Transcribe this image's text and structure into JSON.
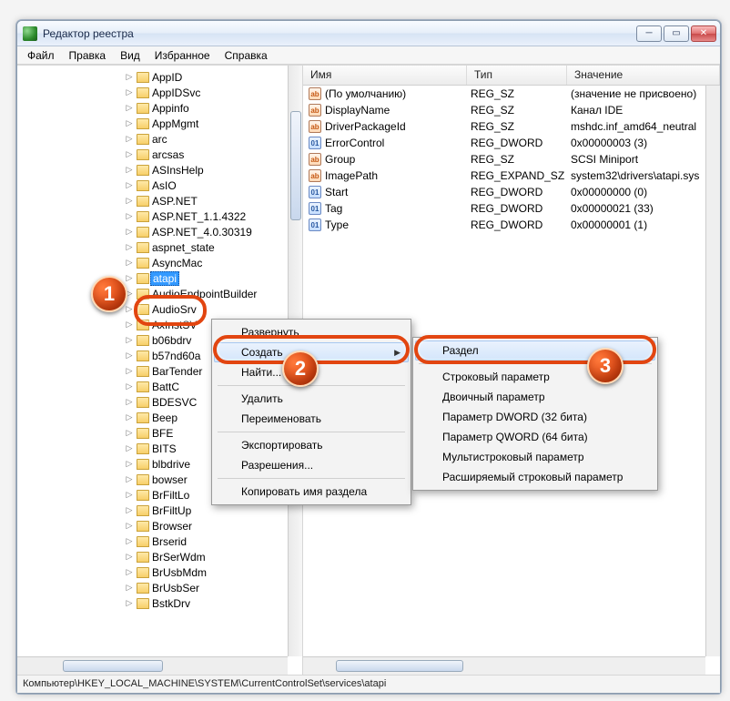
{
  "window": {
    "title": "Редактор реестра"
  },
  "menu": {
    "file": "Файл",
    "edit": "Правка",
    "view": "Вид",
    "fav": "Избранное",
    "help": "Справка"
  },
  "tree": {
    "items": [
      {
        "label": "AppID"
      },
      {
        "label": "AppIDSvc"
      },
      {
        "label": "Appinfo"
      },
      {
        "label": "AppMgmt"
      },
      {
        "label": "arc"
      },
      {
        "label": "arcsas"
      },
      {
        "label": "ASInsHelp"
      },
      {
        "label": "AsIO"
      },
      {
        "label": "ASP.NET"
      },
      {
        "label": "ASP.NET_1.1.4322"
      },
      {
        "label": "ASP.NET_4.0.30319"
      },
      {
        "label": "aspnet_state"
      },
      {
        "label": "AsyncMac"
      },
      {
        "label": "atapi",
        "selected": true
      },
      {
        "label": "AudioEndpointBuilder"
      },
      {
        "label": "AudioSrv"
      },
      {
        "label": "AxInstSV"
      },
      {
        "label": "b06bdrv"
      },
      {
        "label": "b57nd60a"
      },
      {
        "label": "BarTender"
      },
      {
        "label": "BattC"
      },
      {
        "label": "BDESVC"
      },
      {
        "label": "Beep"
      },
      {
        "label": "BFE"
      },
      {
        "label": "BITS"
      },
      {
        "label": "blbdrive"
      },
      {
        "label": "bowser"
      },
      {
        "label": "BrFiltLo"
      },
      {
        "label": "BrFiltUp"
      },
      {
        "label": "Browser"
      },
      {
        "label": "Brserid"
      },
      {
        "label": "BrSerWdm"
      },
      {
        "label": "BrUsbMdm"
      },
      {
        "label": "BrUsbSer"
      },
      {
        "label": "BstkDrv"
      }
    ]
  },
  "list": {
    "headers": {
      "name": "Имя",
      "type": "Тип",
      "value": "Значение"
    },
    "rows": [
      {
        "icon": "str",
        "name": "(По умолчанию)",
        "type": "REG_SZ",
        "value": "(значение не присвоено)"
      },
      {
        "icon": "str",
        "name": "DisplayName",
        "type": "REG_SZ",
        "value": "Канал IDE"
      },
      {
        "icon": "str",
        "name": "DriverPackageId",
        "type": "REG_SZ",
        "value": "mshdc.inf_amd64_neutral"
      },
      {
        "icon": "num",
        "name": "ErrorControl",
        "type": "REG_DWORD",
        "value": "0x00000003 (3)"
      },
      {
        "icon": "str",
        "name": "Group",
        "type": "REG_SZ",
        "value": "SCSI Miniport"
      },
      {
        "icon": "str",
        "name": "ImagePath",
        "type": "REG_EXPAND_SZ",
        "value": "system32\\drivers\\atapi.sys"
      },
      {
        "icon": "num",
        "name": "Start",
        "type": "REG_DWORD",
        "value": "0x00000000 (0)"
      },
      {
        "icon": "num",
        "name": "Tag",
        "type": "REG_DWORD",
        "value": "0x00000021 (33)"
      },
      {
        "icon": "num",
        "name": "Type",
        "type": "REG_DWORD",
        "value": "0x00000001 (1)"
      }
    ]
  },
  "ctx1": {
    "expand": "Развернуть",
    "create": "Создать",
    "find": "Найти...",
    "delete": "Удалить",
    "rename": "Переименовать",
    "export": "Экспортировать",
    "perms": "Разрешения...",
    "copy": "Копировать имя раздела"
  },
  "ctx2": {
    "key": "Раздел",
    "str": "Строковый параметр",
    "bin": "Двоичный параметр",
    "dword": "Параметр DWORD (32 бита)",
    "qword": "Параметр QWORD (64 бита)",
    "multi": "Мультистроковый параметр",
    "expand": "Расширяемый строковый параметр"
  },
  "status": {
    "path": "Компьютер\\HKEY_LOCAL_MACHINE\\SYSTEM\\CurrentControlSet\\services\\atapi"
  },
  "markers": {
    "m1": "1",
    "m2": "2",
    "m3": "3"
  }
}
